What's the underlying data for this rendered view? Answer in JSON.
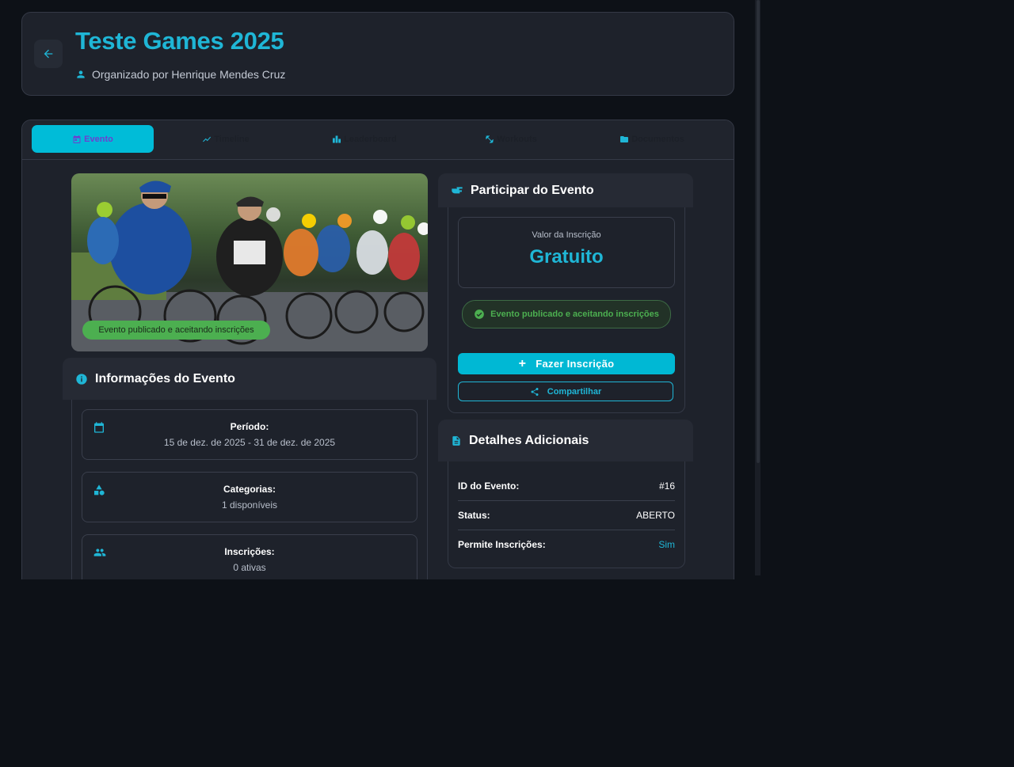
{
  "header": {
    "title": "Teste Games 2025",
    "organizer": "Organizado por Henrique Mendes Cruz"
  },
  "tabs": [
    {
      "label": "Evento",
      "icon": "calendar-icon",
      "active": true
    },
    {
      "label": "Timeline",
      "icon": "trend-line-icon",
      "active": false
    },
    {
      "label": "Leaderboard",
      "icon": "bar-chart-icon",
      "active": false
    },
    {
      "label": "Workouts",
      "icon": "dumbbell-icon",
      "active": false
    },
    {
      "label": "Documentos",
      "icon": "folder-icon",
      "active": false
    }
  ],
  "hero": {
    "image": "cyclists-race-photo",
    "status_badge": "Evento publicado e aceitando inscrições"
  },
  "info": {
    "title": "Informações do Evento",
    "rows": [
      {
        "label": "Período:",
        "value": "15 de dez. de 2025 - 31 de dez. de 2025",
        "icon": "calendar-icon"
      },
      {
        "label": "Categorias:",
        "value": "1 disponíveis",
        "icon": "category-icon"
      },
      {
        "label": "Inscrições:",
        "value": "0 ativas",
        "icon": "people-icon"
      }
    ]
  },
  "participate": {
    "title": "Participar do Evento",
    "price_label": "Valor da Inscrição",
    "price_value": "Gratuito",
    "status": "Evento publicado e aceitando inscrições",
    "register_button": "Fazer Inscrição",
    "share_button": "Compartilhar"
  },
  "details": {
    "title": "Detalhes Adicionais",
    "rows": [
      {
        "key": "ID do Evento:",
        "value": "#16"
      },
      {
        "key": "Status:",
        "value": "ABERTO"
      },
      {
        "key": "Permite Inscrições:",
        "value": "Sim"
      }
    ]
  },
  "colors": {
    "accent": "#1fb6d6",
    "primary_button": "#00b8d4",
    "success": "#4caf50",
    "background": "#0d1117",
    "card": "#1e222b"
  }
}
